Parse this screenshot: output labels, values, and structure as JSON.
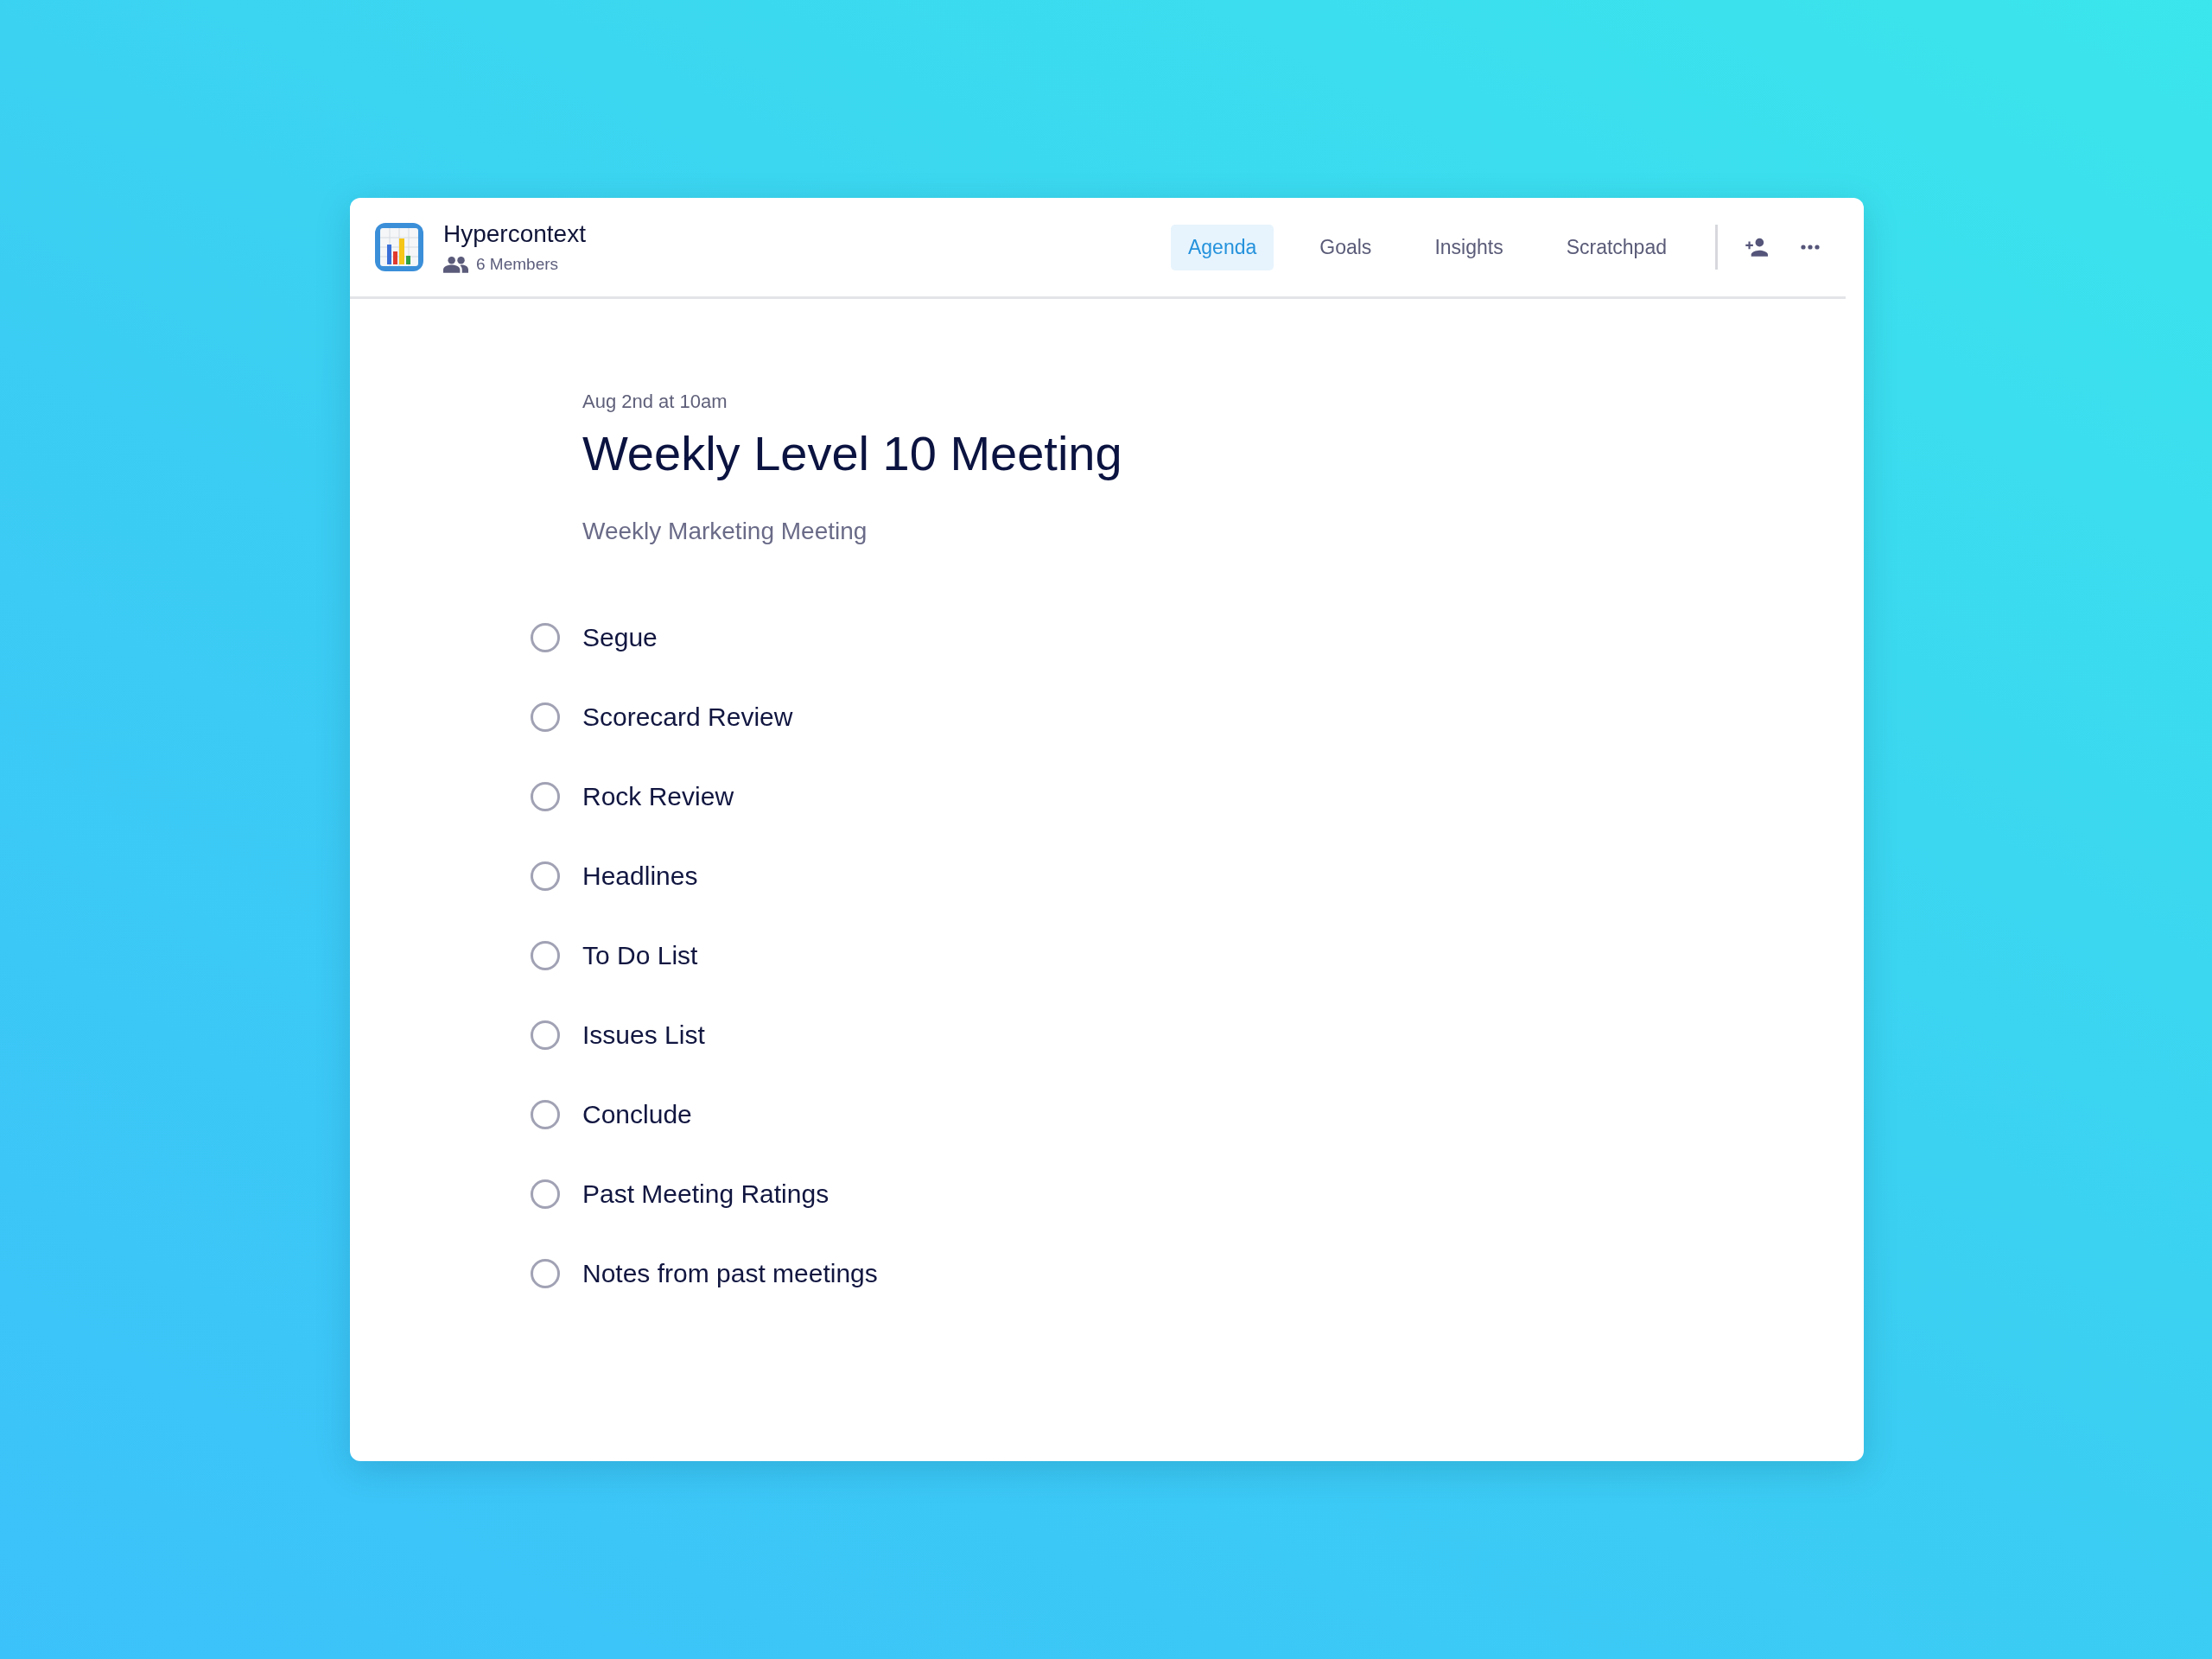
{
  "workspace": {
    "name": "Hypercontext",
    "members": "6 Members"
  },
  "tabs": [
    {
      "label": "Agenda",
      "selected": true
    },
    {
      "label": "Goals",
      "selected": false
    },
    {
      "label": "Insights",
      "selected": false
    },
    {
      "label": "Scratchpad",
      "selected": false
    }
  ],
  "meeting": {
    "date": "Aug 2nd at 10am",
    "title": "Weekly Level 10 Meeting",
    "description": "Weekly Marketing Meeting"
  },
  "agenda_items": [
    {
      "label": "Segue",
      "checked": false
    },
    {
      "label": "Scorecard Review",
      "checked": false
    },
    {
      "label": "Rock Review",
      "checked": false
    },
    {
      "label": "Headlines",
      "checked": false
    },
    {
      "label": "To Do List",
      "checked": false
    },
    {
      "label": "Issues List",
      "checked": false
    },
    {
      "label": "Conclude",
      "checked": false
    },
    {
      "label": "Past Meeting Ratings",
      "checked": false
    },
    {
      "label": "Notes from past meetings",
      "checked": false
    }
  ]
}
